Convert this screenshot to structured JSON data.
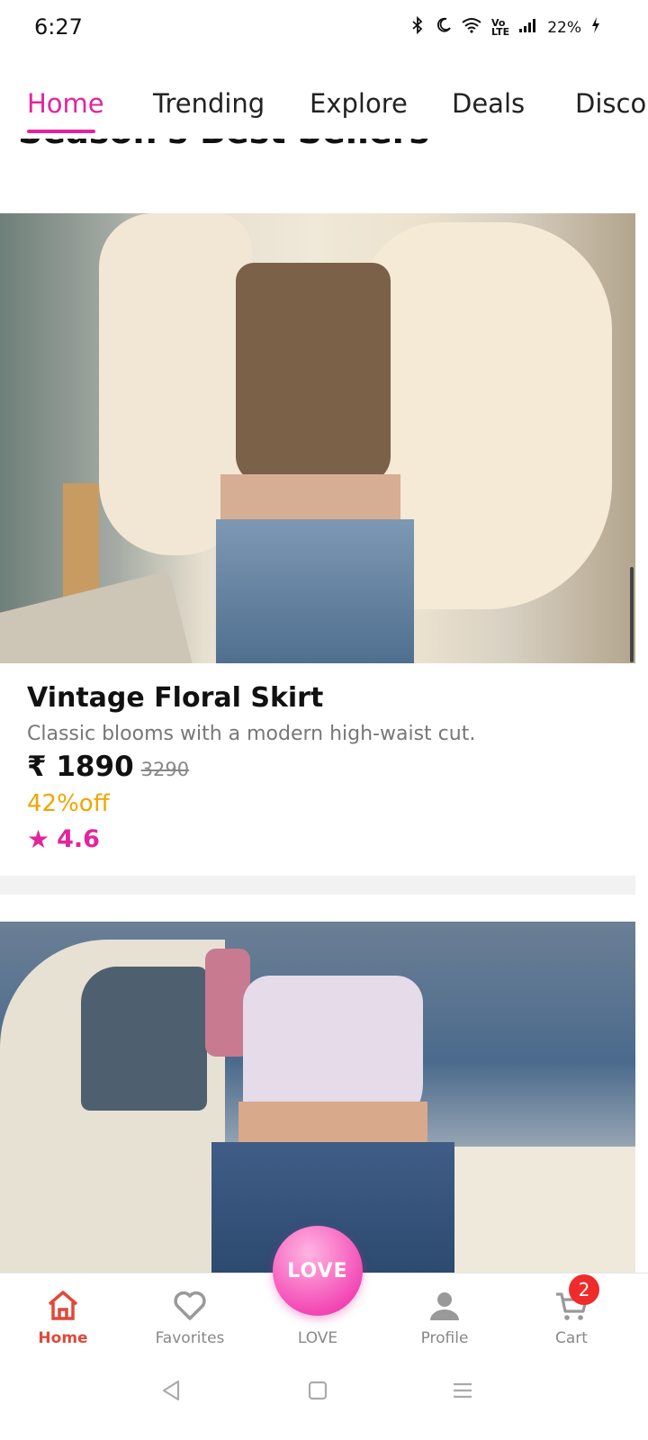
{
  "status_bar": {
    "time": "6:27",
    "battery": "22%",
    "icons": [
      "bluetooth-icon",
      "do-not-disturb-icon",
      "wifi-icon",
      "volte-icon",
      "signal-icon",
      "battery-icon"
    ]
  },
  "tabs": [
    {
      "label": "Home",
      "active": true
    },
    {
      "label": "Trending",
      "active": false
    },
    {
      "label": "Explore",
      "active": false
    },
    {
      "label": "Deals",
      "active": false
    },
    {
      "label": "Disco",
      "active": false
    }
  ],
  "section": {
    "title": "Season's Best Sellers"
  },
  "product": {
    "name": "Vintage Floral Skirt",
    "description": "Classic blooms with a modern high-waist cut.",
    "price": "₹ 1890",
    "original_price": "3290",
    "discount": "42%off",
    "rating": "4.6"
  },
  "bottom_nav": {
    "items": [
      {
        "label": "Home",
        "icon": "home-icon",
        "active": true
      },
      {
        "label": "Favorites",
        "icon": "heart-icon",
        "active": false
      },
      {
        "label": "LOVE",
        "icon": "love-button",
        "active": false
      },
      {
        "label": "Profile",
        "icon": "user-icon",
        "active": false
      },
      {
        "label": "Cart",
        "icon": "cart-icon",
        "active": false
      }
    ],
    "love_button_text": "LOVE",
    "cart_badge": "2"
  },
  "colors": {
    "accent": "#e3249d",
    "active_nav": "#e0493a",
    "discount": "#f0a500",
    "badge": "#ef2b2b"
  }
}
